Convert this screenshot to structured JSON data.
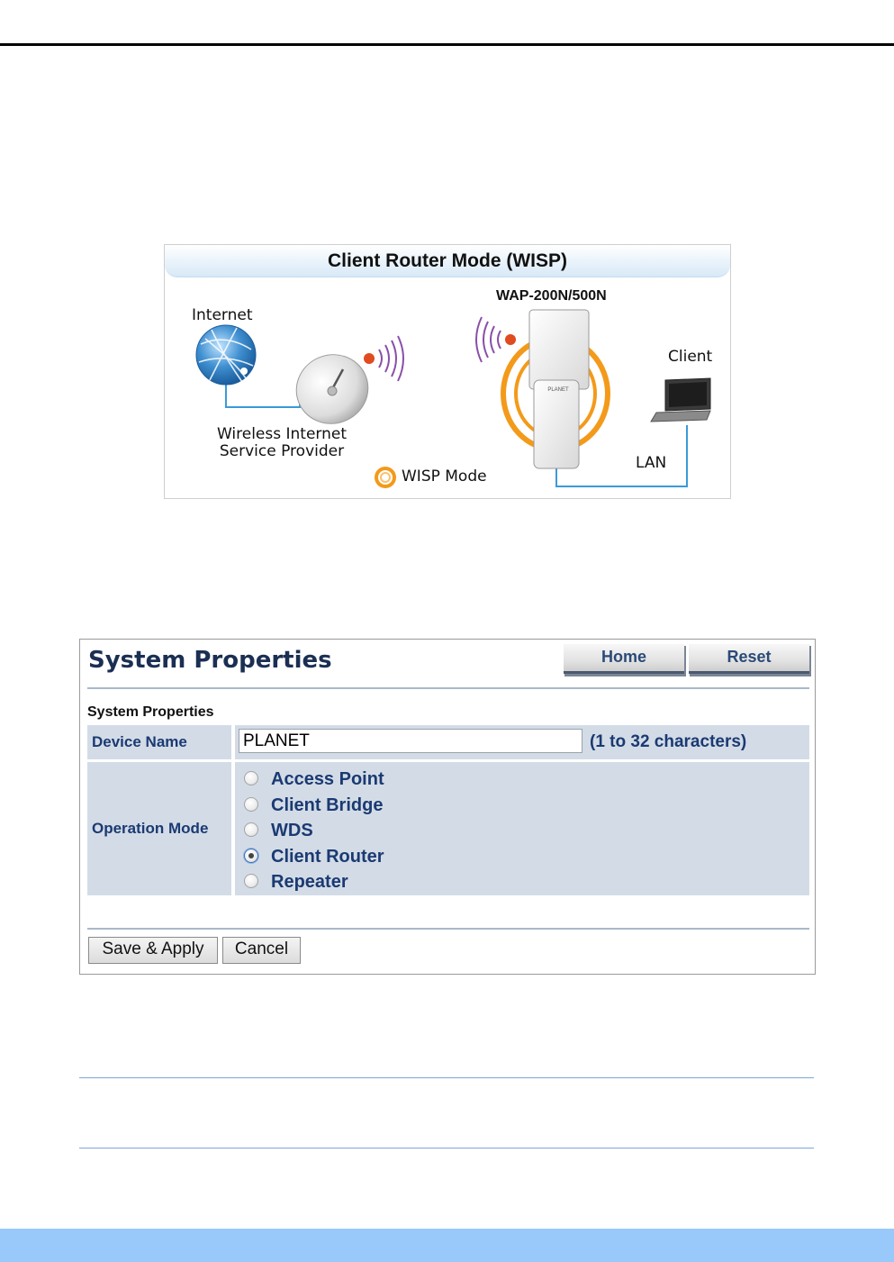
{
  "diagram": {
    "title": "Client Router Mode (WISP)",
    "internet_label": "Internet",
    "device_label": "WAP-200N/500N",
    "client_label": "Client",
    "wisp_label_line1": "Wireless Internet",
    "wisp_label_line2": "Service Provider",
    "mode_label": "WISP Mode",
    "lan_label": "LAN",
    "device_brand": "PLANET"
  },
  "panel": {
    "title": "System Properties",
    "home_label": "Home",
    "reset_label": "Reset",
    "section_label": "System Properties",
    "device_name_label": "Device Name",
    "device_name_value": "PLANET",
    "device_name_hint": "(1 to 32 characters)",
    "operation_mode_label": "Operation Mode",
    "modes": [
      {
        "label": "Access Point",
        "checked": false
      },
      {
        "label": "Client Bridge",
        "checked": false
      },
      {
        "label": "WDS",
        "checked": false
      },
      {
        "label": "Client Router",
        "checked": true
      },
      {
        "label": "Repeater",
        "checked": false
      }
    ],
    "save_label": "Save & Apply",
    "cancel_label": "Cancel"
  },
  "colors": {
    "title_navy": "#1b2f53",
    "label_blue": "#1b3a73",
    "cell_bg": "#d3dce6",
    "wisp_orange": "#f39a1b",
    "signal_purple": "#8a4fa8",
    "link_blue": "#3b9ad9",
    "footer_blue": "#99c9fb"
  }
}
